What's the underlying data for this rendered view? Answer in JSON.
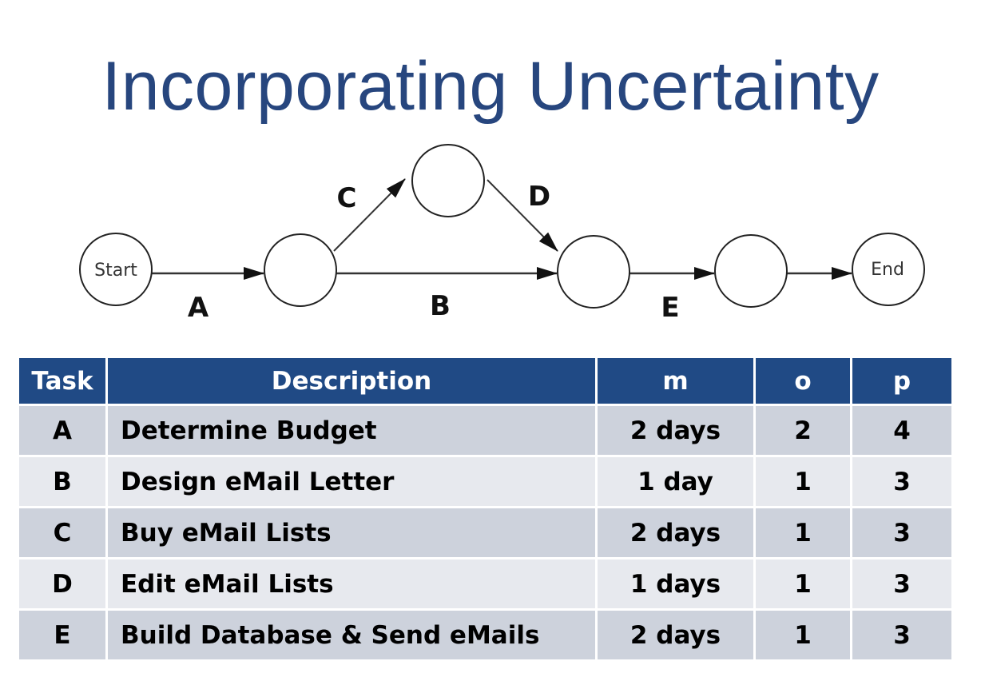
{
  "title": "Incorporating Uncertainty",
  "diagram": {
    "nodes": [
      {
        "id": "start",
        "label": "Start"
      },
      {
        "id": "n1",
        "label": ""
      },
      {
        "id": "n2",
        "label": ""
      },
      {
        "id": "n3",
        "label": ""
      },
      {
        "id": "n4",
        "label": ""
      },
      {
        "id": "end",
        "label": "End"
      }
    ],
    "edges": [
      {
        "from": "start",
        "to": "n1",
        "label": "A"
      },
      {
        "from": "n1",
        "to": "n2",
        "label": "C"
      },
      {
        "from": "n2",
        "to": "n3",
        "label": "D"
      },
      {
        "from": "n1",
        "to": "n3",
        "label": "B"
      },
      {
        "from": "n3",
        "to": "n4",
        "label": "E"
      },
      {
        "from": "n4",
        "to": "end",
        "label": ""
      }
    ]
  },
  "table": {
    "headers": [
      "Task",
      "Description",
      "m",
      "o",
      "p"
    ],
    "rows": [
      {
        "task": "A",
        "description": "Determine Budget",
        "m": "2 days",
        "o": "2",
        "p": "4"
      },
      {
        "task": "B",
        "description": "Design eMail Letter",
        "m": "1 day",
        "o": "1",
        "p": "3"
      },
      {
        "task": "C",
        "description": "Buy eMail Lists",
        "m": "2 days",
        "o": "1",
        "p": "3"
      },
      {
        "task": "D",
        "description": "Edit eMail Lists",
        "m": "1 days",
        "o": "1",
        "p": "3"
      },
      {
        "task": "E",
        "description": "Build Database & Send eMails",
        "m": "2 days",
        "o": "1",
        "p": "3"
      }
    ]
  }
}
